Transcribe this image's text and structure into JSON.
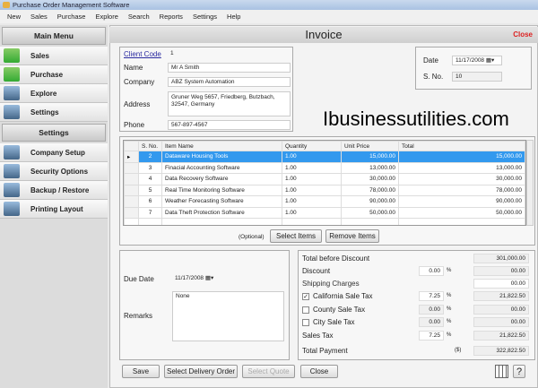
{
  "app": {
    "title": "Purchase Order Management Software"
  },
  "menu": [
    "New",
    "Sales",
    "Purchase",
    "Explore",
    "Search",
    "Reports",
    "Settings",
    "Help"
  ],
  "sidebar": {
    "main_title": "Main Menu",
    "main_items": [
      "Sales",
      "Purchase",
      "Explore",
      "Settings"
    ],
    "settings_title": "Settings",
    "settings_items": [
      "Company Setup",
      "Security Options",
      "Backup / Restore",
      "Printing Layout"
    ]
  },
  "invoice": {
    "title": "Invoice",
    "close": "Close"
  },
  "client": {
    "code_label": "Client Code",
    "code": "1",
    "name_label": "Name",
    "name": "Mr A Smith",
    "company_label": "Company",
    "company": "ABZ System Automation",
    "address_label": "Address",
    "address": "Gruner Weg 5657, Friedberg, Butzbach, 32547, Germany",
    "phone_label": "Phone",
    "phone": "567-897-4567"
  },
  "meta": {
    "date_label": "Date",
    "date": "11/17/2008",
    "sno_label": "S. No.",
    "sno": "10"
  },
  "watermark": "Ibusinessutilities.com",
  "grid": {
    "headers": [
      "S. No.",
      "Item Name",
      "Quantity",
      "Unit Price",
      "Total"
    ],
    "rows": [
      [
        "2",
        "Dataware Housing Tools",
        "1.00",
        "15,000.00",
        "15,000.00"
      ],
      [
        "3",
        "Finacial Accounting Software",
        "1.00",
        "13,000.00",
        "13,000.00"
      ],
      [
        "4",
        "Data Recovery Software",
        "1.00",
        "30,000.00",
        "30,000.00"
      ],
      [
        "5",
        "Real Time Monitoring Software",
        "1.00",
        "78,000.00",
        "78,000.00"
      ],
      [
        "6",
        "Weather Forecasting Software",
        "1.00",
        "90,000.00",
        "90,000.00"
      ],
      [
        "7",
        "Data Theft Protection Software",
        "1.00",
        "50,000.00",
        "50,000.00"
      ]
    ],
    "optional": "(Optional)",
    "select_items": "Select Items",
    "remove_items": "Remove Items"
  },
  "due": {
    "due_label": "Due Date",
    "due_date": "11/17/2008",
    "remarks_label": "Remarks",
    "remarks": "None"
  },
  "totals": {
    "before_discount_label": "Total before Discount",
    "before_discount": "301,000.00",
    "discount_label": "Discount",
    "discount_pct": "0.00",
    "discount": "00.00",
    "shipping_label": "Shipping Charges",
    "shipping": "00.00",
    "ca_label": "California Sale Tax",
    "ca_pct": "7.25",
    "ca": "21,822.50",
    "county_label": "County Sale Tax",
    "county_pct": "0.00",
    "county": "00.00",
    "city_label": "City Sale Tax",
    "city_pct": "0.00",
    "city": "00.00",
    "sales_tax_label": "Sales Tax",
    "sales_tax_pct": "7.25",
    "sales_tax": "21,822.50",
    "total_label": "Total Payment",
    "currency": "($)",
    "total": "322,822.50",
    "pct": "%"
  },
  "buttons": {
    "save": "Save",
    "delivery": "Select Delivery Order",
    "quote": "Select Quote",
    "close": "Close",
    "help": "?"
  }
}
